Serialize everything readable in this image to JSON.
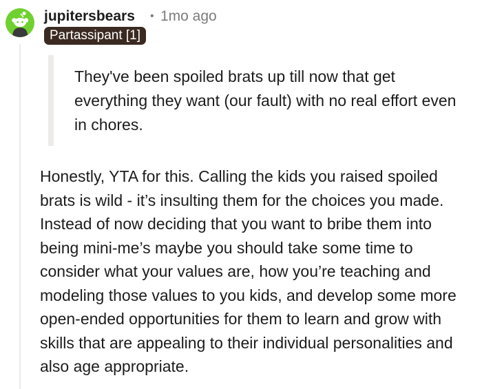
{
  "comment": {
    "author": "jupitersbears",
    "separator": "•",
    "time_ago": "1mo ago",
    "flair": "Partassipant [1]",
    "quote": "They've been spoiled brats up till now that get everything they want (our fault) with no real effort even in chores.",
    "body": "Honestly, YTA for this. Calling the kids you raised spoiled brats is wild - it’s insulting them for the choices you made. Instead of now deciding that you want to bribe them into being mini-me’s maybe you should take some time to consider what your values are, how you’re teaching and modeling those values to you kids, and develop some more open-ended opportunities for them to learn and grow with skills that are appealing to their individual personalities and also age appropriate."
  },
  "colors": {
    "avatar_bg": "#6fd12f",
    "flair_bg": "#3b2a21",
    "text": "#1c1c1c",
    "muted": "#7c7c7c"
  }
}
